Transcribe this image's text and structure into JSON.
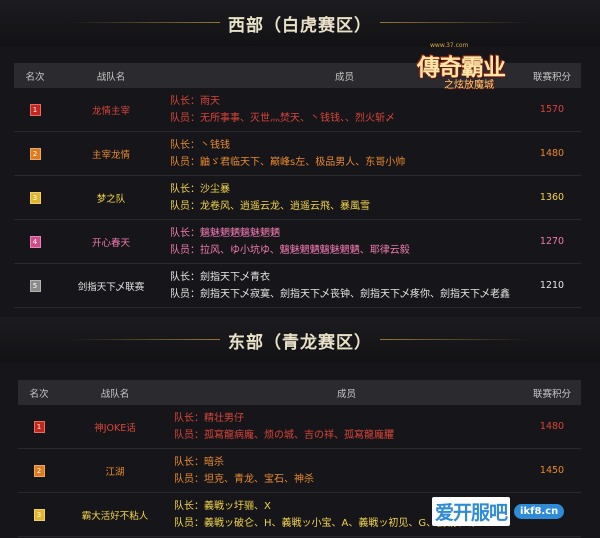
{
  "west": {
    "title": "西部（白虎赛区）",
    "headers": {
      "rank": "名次",
      "team": "战队名",
      "members": "成员",
      "score": "联赛积分"
    },
    "rows": [
      {
        "rank": "1",
        "badge_color": "#c8251a",
        "name_color": "#d8443a",
        "text_color": "#d8443a",
        "team": "龙情主宰",
        "captain": "队长：雨天",
        "members": "队员：无所事事、灭世灬焚天、丶钱钱、、烈火斩〆",
        "score": "1570"
      },
      {
        "rank": "2",
        "badge_color": "#e07a1a",
        "name_color": "#e8892d",
        "text_color": "#e8892d",
        "team": "主宰龙情",
        "captain": "队长：丶钱钱",
        "members": "队员：鼬ゞ君临天下、巅峰s左、极品男人、东哥小帅",
        "score": "1480"
      },
      {
        "rank": "3",
        "badge_color": "#e2b52a",
        "name_color": "#f1d44a",
        "text_color": "#f1d44a",
        "team": "梦之队",
        "captain": "队长：沙尘暴",
        "members": "队员：龙卷风、逍遥云龙、逍遥云飛、暴風雪",
        "score": "1360"
      },
      {
        "rank": "4",
        "badge_color": "#d14a8a",
        "name_color": "#f07ab0",
        "text_color": "#f07ab0",
        "team": "开心春天",
        "captain": "队长：魑魅魍魉魑魅魍魉",
        "members": "队员：拉风、ゆ小坑ゆ、魑魅魍魉魑魅魍魉、耶律云毅",
        "score": "1270"
      },
      {
        "rank": "5",
        "badge_color": "#8a8a8a",
        "name_color": "#e6e6e6",
        "text_color": "#e6e6e6",
        "team": "剑指天下乄联赛",
        "captain": "队长：劍指天下乄青衣",
        "members": "队员：劍指天下乄寂寞、劍指天下乄丧钟、劍指天下乄疼你、劍指天下乄老鑫",
        "score": "1210"
      }
    ]
  },
  "east": {
    "title": "东部（青龙赛区）",
    "headers": {
      "rank": "名次",
      "team": "战队名",
      "members": "成员",
      "score": "联赛积分"
    },
    "rows": [
      {
        "rank": "1",
        "badge_color": "#c8251a",
        "name_color": "#d8443a",
        "text_color": "#d8443a",
        "team": "神JOKE话",
        "captain": "队长：精壮男仔",
        "members": "队员：孤寫龍病龐、烦の城、吉の祥、孤寫龍龐臞",
        "score": "1480"
      },
      {
        "rank": "2",
        "badge_color": "#e07a1a",
        "name_color": "#e8892d",
        "text_color": "#e8892d",
        "team": "江湖",
        "captain": "队长：暗杀",
        "members": "队员：坦克、青龙、宝石、神杀",
        "score": "1450"
      },
      {
        "rank": "3",
        "badge_color": "#e2b52a",
        "name_color": "#f1d44a",
        "text_color": "#f1d44a",
        "team": "霸大活好不粘人",
        "captain": "队长：義戦ッ圩骊、X",
        "members": "队员：義戦ッ破仑、H、義戦ッ小宝、A、義戦ッ初见、G、義戦ッ嘭",
        "score": ""
      }
    ]
  },
  "logo": {
    "site": "www.37.com",
    "main": "傳奇霸业",
    "sub": "之炫放魔城"
  },
  "watermark": {
    "text": "爱开服吧",
    "url": "ikf8.cn"
  }
}
